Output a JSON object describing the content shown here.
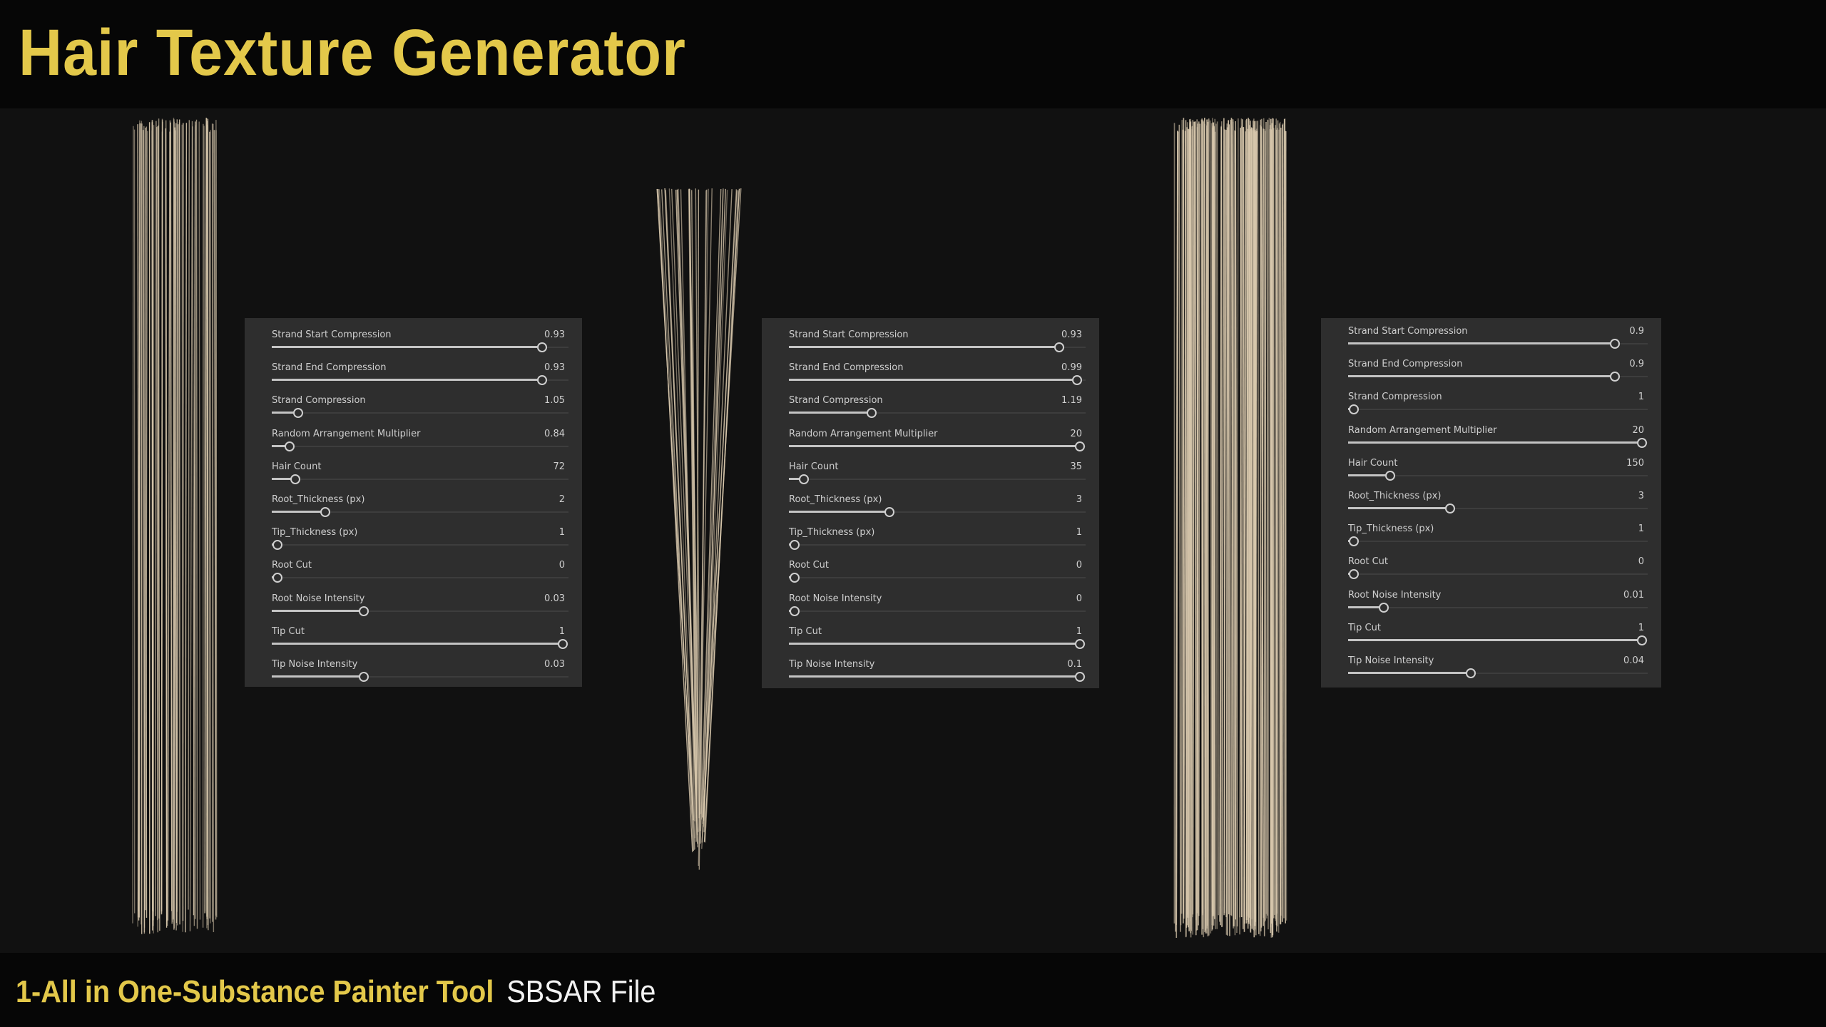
{
  "header": {
    "title": "Hair Texture Generator"
  },
  "footer": {
    "highlight": "1-All in One-Substance Painter Tool",
    "suffix": "SBSAR File"
  },
  "colors": {
    "accent": "#e3c84a",
    "hair": "#d8c8ad",
    "panel_bg": "#2e2e2e"
  },
  "hair_previews": [
    {
      "name": "hair-preview-1",
      "shape": "straight",
      "hair_count": 72
    },
    {
      "name": "hair-preview-2",
      "shape": "tapered",
      "hair_count": 35
    },
    {
      "name": "hair-preview-3",
      "shape": "straight-dense",
      "hair_count": 150
    }
  ],
  "panels": [
    {
      "params": [
        {
          "label": "Strand Start Compression",
          "value": "0.93",
          "fill": 0.91
        },
        {
          "label": "Strand End Compression",
          "value": "0.93",
          "fill": 0.91
        },
        {
          "label": "Strand Compression",
          "value": "1.05",
          "fill": 0.09
        },
        {
          "label": "Random Arrangement Multiplier",
          "value": "0.84",
          "fill": 0.06
        },
        {
          "label": "Hair Count",
          "value": "72",
          "fill": 0.08
        },
        {
          "label": "Root_Thickness (px)",
          "value": "2",
          "fill": 0.18
        },
        {
          "label": "Tip_Thickness (px)",
          "value": "1",
          "fill": 0.02
        },
        {
          "label": "Root Cut",
          "value": "0",
          "fill": 0.02
        },
        {
          "label": "Root Noise Intensity",
          "value": "0.03",
          "fill": 0.31
        },
        {
          "label": "Tip Cut",
          "value": "1",
          "fill": 0.98
        },
        {
          "label": "Tip Noise Intensity",
          "value": "0.03",
          "fill": 0.31
        }
      ]
    },
    {
      "params": [
        {
          "label": "Strand Start Compression",
          "value": "0.93",
          "fill": 0.91
        },
        {
          "label": "Strand End Compression",
          "value": "0.99",
          "fill": 0.97
        },
        {
          "label": "Strand Compression",
          "value": "1.19",
          "fill": 0.28
        },
        {
          "label": "Random Arrangement Multiplier",
          "value": "20",
          "fill": 0.98
        },
        {
          "label": "Hair Count",
          "value": "35",
          "fill": 0.05
        },
        {
          "label": "Root_Thickness (px)",
          "value": "3",
          "fill": 0.34
        },
        {
          "label": "Tip_Thickness (px)",
          "value": "1",
          "fill": 0.02
        },
        {
          "label": "Root Cut",
          "value": "0",
          "fill": 0.02
        },
        {
          "label": "Root Noise Intensity",
          "value": "0",
          "fill": 0.02
        },
        {
          "label": "Tip Cut",
          "value": "1",
          "fill": 0.98
        },
        {
          "label": "Tip Noise Intensity",
          "value": "0.1",
          "fill": 0.98
        }
      ]
    },
    {
      "params": [
        {
          "label": "Strand Start Compression",
          "value": "0.9",
          "fill": 0.89
        },
        {
          "label": "Strand End Compression",
          "value": "0.9",
          "fill": 0.89
        },
        {
          "label": "Strand Compression",
          "value": "1",
          "fill": 0.02
        },
        {
          "label": "Random Arrangement Multiplier",
          "value": "20",
          "fill": 0.98
        },
        {
          "label": "Hair Count",
          "value": "150",
          "fill": 0.14
        },
        {
          "label": "Root_Thickness (px)",
          "value": "3",
          "fill": 0.34
        },
        {
          "label": "Tip_Thickness (px)",
          "value": "1",
          "fill": 0.02
        },
        {
          "label": "Root Cut",
          "value": "0",
          "fill": 0.02
        },
        {
          "label": "Root Noise Intensity",
          "value": "0.01",
          "fill": 0.12
        },
        {
          "label": "Tip Cut",
          "value": "1",
          "fill": 0.98
        },
        {
          "label": "Tip Noise Intensity",
          "value": "0.04",
          "fill": 0.41
        }
      ]
    }
  ]
}
